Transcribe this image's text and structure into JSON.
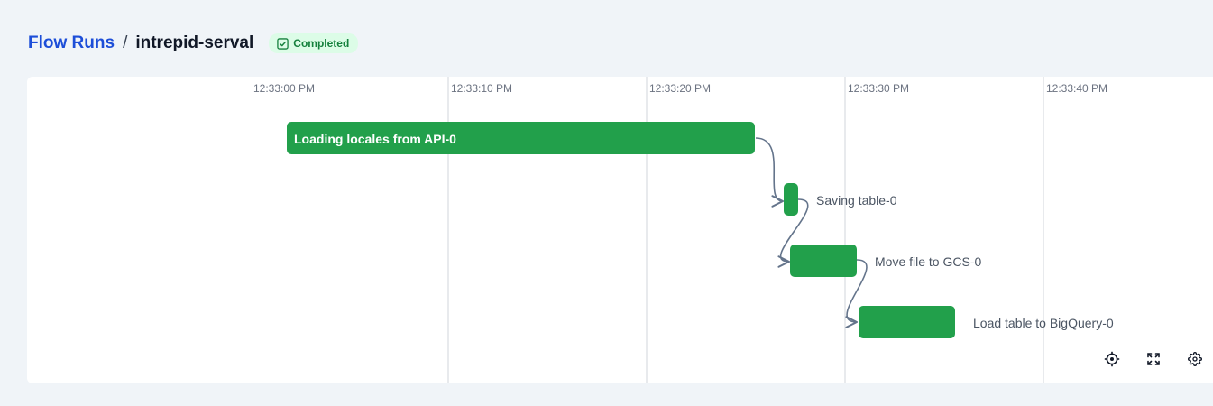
{
  "breadcrumb": {
    "parent": "Flow Runs",
    "separator": "/",
    "current": "intrepid-serval"
  },
  "status": {
    "label": "Completed",
    "color": "#15803d",
    "background": "#dcfce7"
  },
  "timeline": {
    "ticks": [
      "12:33:00 PM",
      "12:33:10 PM",
      "12:33:20 PM",
      "12:33:30 PM",
      "12:33:40 PM"
    ],
    "bar_color": "#22a04b",
    "edge_color": "#64748b",
    "grid_color": "#d1d5db",
    "tasks": [
      {
        "name": "Loading locales from API-0",
        "label_inside": true
      },
      {
        "name": "Saving table-0",
        "label_inside": false
      },
      {
        "name": "Move file to GCS-0",
        "label_inside": false
      },
      {
        "name": "Load table to BigQuery-0",
        "label_inside": false
      }
    ]
  },
  "controls": {
    "recenter_icon": "crosshair-icon",
    "fullscreen_icon": "expand-icon",
    "settings_icon": "gear-icon"
  }
}
